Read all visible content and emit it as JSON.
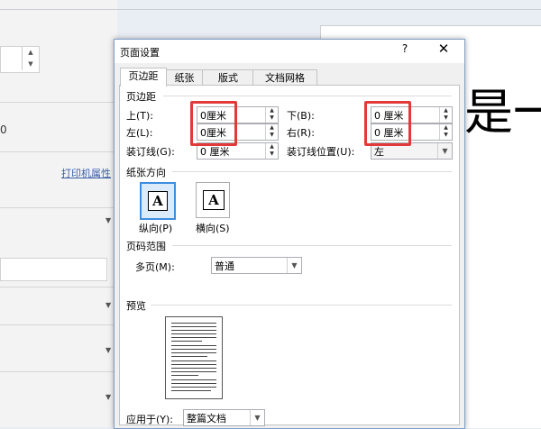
{
  "background": {
    "field_value": "0",
    "printer_link": "打印机属性",
    "doc_text": "是一"
  },
  "dialog": {
    "title": "页面设置",
    "help_label": "?",
    "close_label": "✕",
    "tabs": [
      "页边距",
      "纸张",
      "版式",
      "文档网格"
    ],
    "margins": {
      "section": "页边距",
      "top_label": "上(T):",
      "top_value": "0厘米",
      "bottom_label": "下(B):",
      "bottom_value": "0 厘米",
      "left_label": "左(L):",
      "left_value": "0厘米",
      "right_label": "右(R):",
      "right_value": "0 厘米",
      "gutter_label": "装订线(G):",
      "gutter_value": "0 厘米",
      "gutter_pos_label": "装订线位置(U):",
      "gutter_pos_value": "左"
    },
    "orientation": {
      "section": "纸张方向",
      "portrait_label": "纵向(P)",
      "landscape_label": "横向(S)",
      "icon_letter": "A",
      "selected": "portrait"
    },
    "pages": {
      "section": "页码范围",
      "multi_label": "多页(M):",
      "multi_value": "普通"
    },
    "preview": {
      "section": "预览",
      "apply_label": "应用于(Y):",
      "apply_value": "整篇文档"
    },
    "highlight_color": "#e23a3a",
    "accent_color": "#3d8ee0"
  }
}
